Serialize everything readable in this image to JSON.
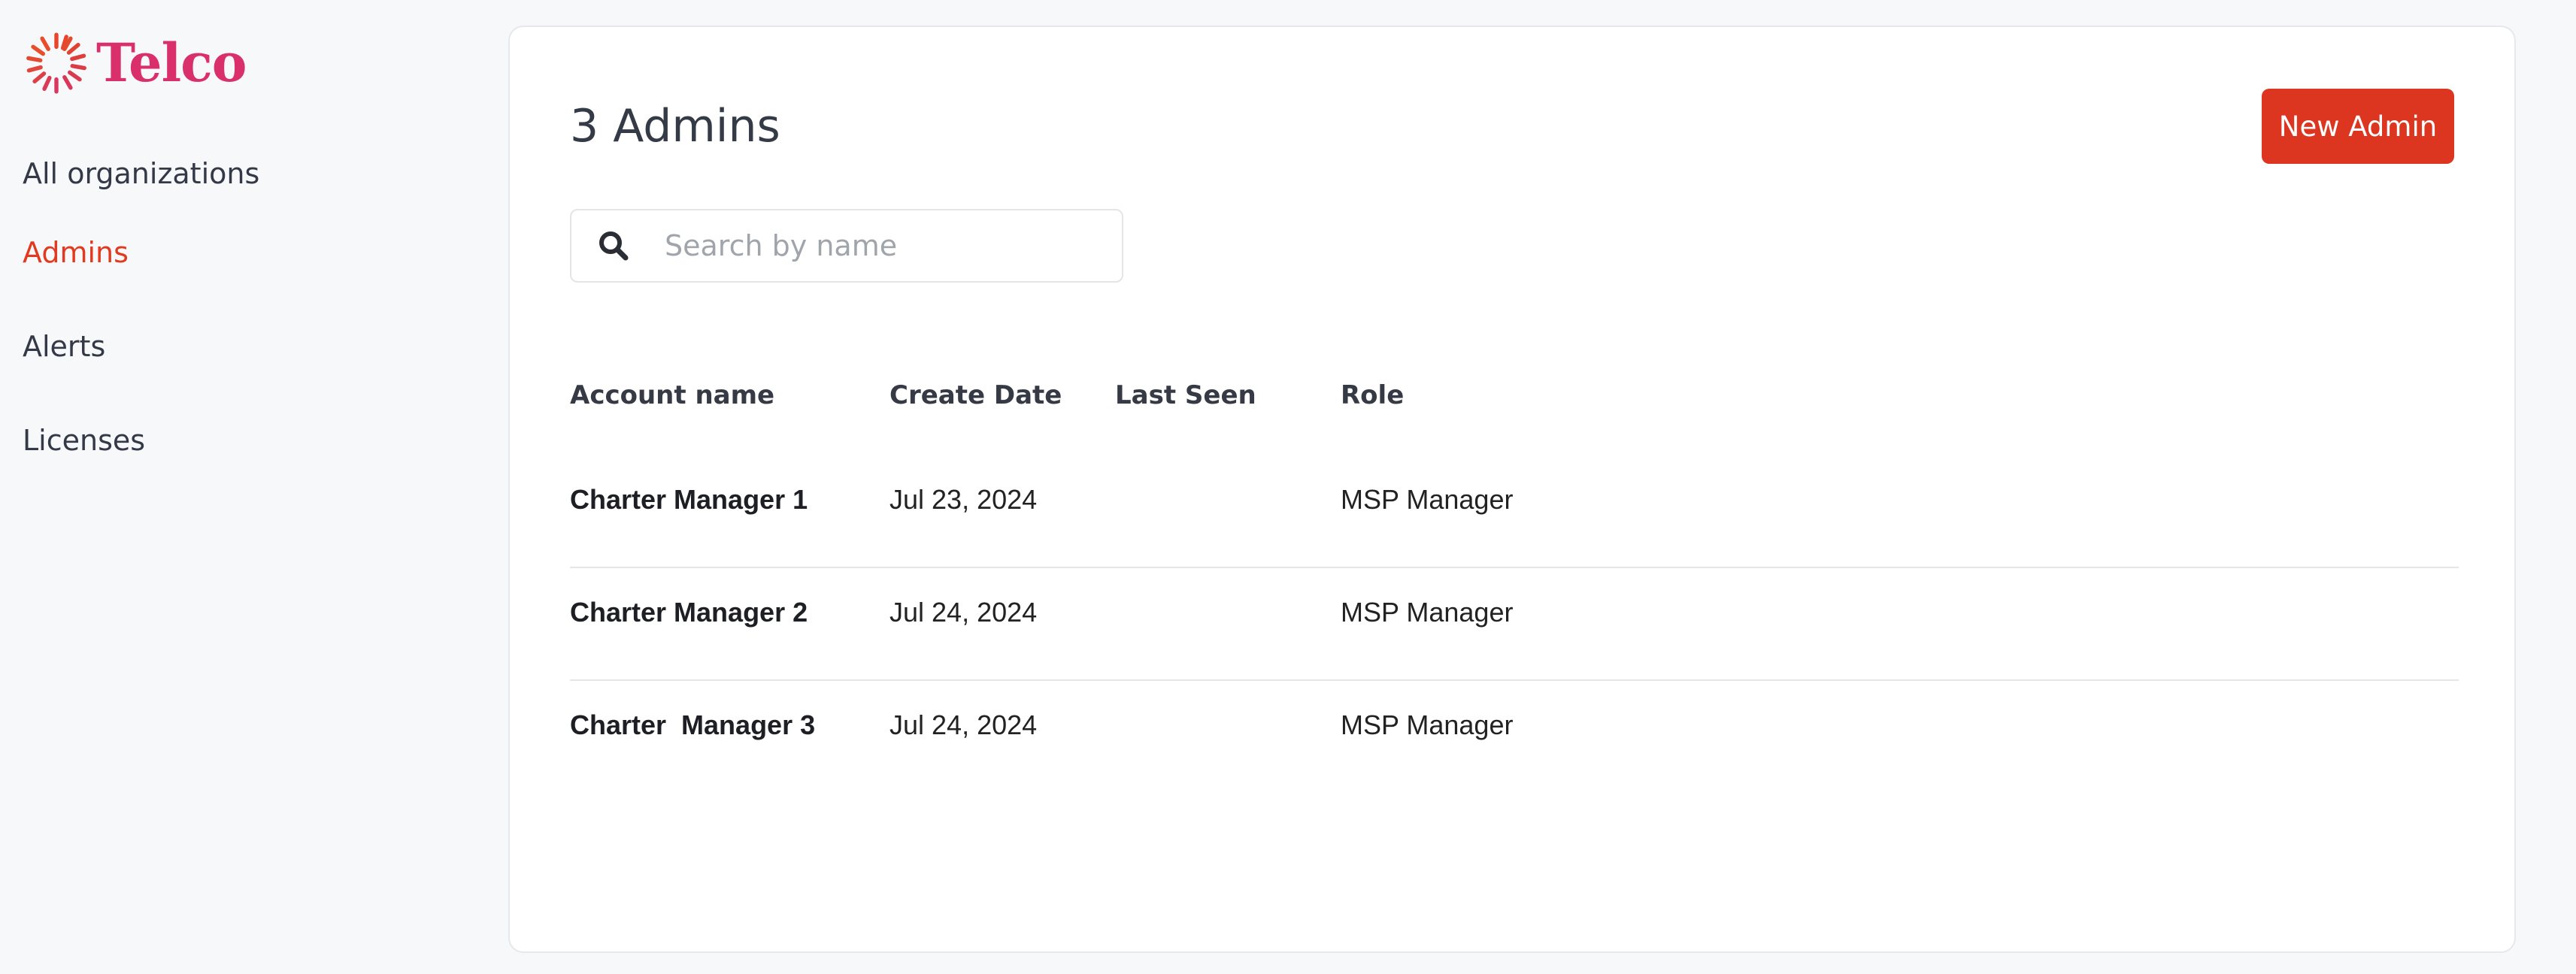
{
  "brand": {
    "name": "Telco",
    "logo_icon": "sunburst-logo-icon",
    "brand_color": "#d92f6b",
    "accent_color": "#e03a1f"
  },
  "sidebar": {
    "items": [
      {
        "label": "All organizations",
        "active": false
      },
      {
        "label": "Admins",
        "active": true
      },
      {
        "label": "Alerts",
        "active": false
      },
      {
        "label": "Licenses",
        "active": false
      }
    ]
  },
  "main": {
    "title": "3 Admins",
    "new_button_label": "New Admin",
    "search": {
      "placeholder": "Search by name",
      "value": "",
      "icon": "search-icon"
    },
    "table": {
      "columns": [
        "Account name",
        "Create Date",
        "Last Seen",
        "Role"
      ],
      "rows": [
        {
          "account_name": "Charter Manager 1",
          "create_date": "Jul 23, 2024",
          "last_seen": "",
          "role": "MSP Manager"
        },
        {
          "account_name": "Charter Manager 2",
          "create_date": "Jul 24, 2024",
          "last_seen": "",
          "role": "MSP Manager"
        },
        {
          "account_name": "Charter  Manager 3",
          "create_date": "Jul 24, 2024",
          "last_seen": "",
          "role": "MSP Manager"
        }
      ]
    }
  }
}
